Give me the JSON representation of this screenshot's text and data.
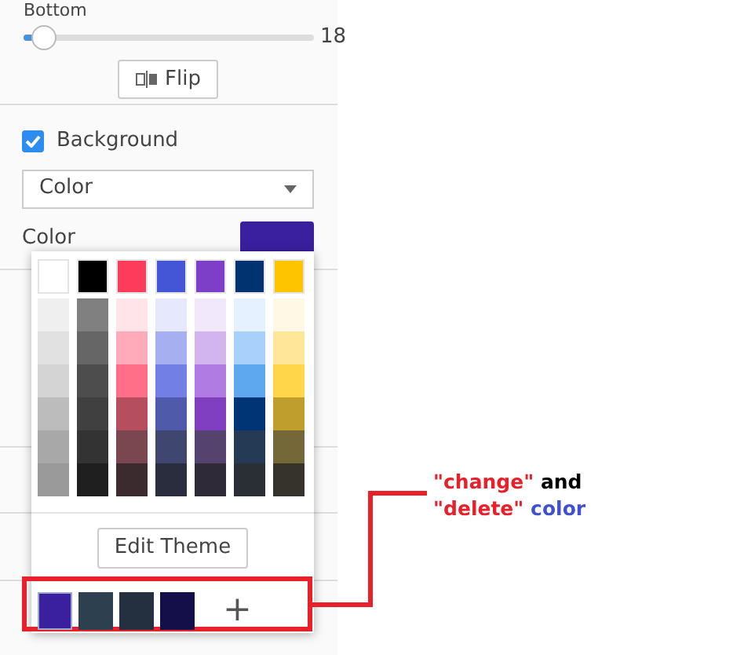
{
  "slider": {
    "label": "Bottom",
    "level": 0.07,
    "reading": "18"
  },
  "flip_button": {
    "label": "Flip"
  },
  "background": {
    "label": "Background",
    "checked": true,
    "fill_type": "Color",
    "color_label": "Color",
    "color": "#3a1f9e"
  },
  "color_picker": {
    "theme_colors": [
      {
        "color": "#ffffff"
      },
      {
        "color": "#000000"
      },
      {
        "color": "#ff3b5b"
      },
      {
        "color": "#4455d6"
      },
      {
        "color": "#7e3fc8"
      },
      {
        "color": "#003370"
      },
      {
        "color": "#ffc400"
      }
    ],
    "shades": [
      [
        {
          "color": "#efefef"
        },
        {
          "color": "#808080"
        },
        {
          "color": "#ffe5ea"
        },
        {
          "color": "#e6e9fb"
        },
        {
          "color": "#f1e8fb"
        },
        {
          "color": "#e5f1ff"
        },
        {
          "color": "#fff8e5"
        }
      ],
      [
        {
          "color": "#e1e1e1"
        },
        {
          "color": "#666666"
        },
        {
          "color": "#ffabb9"
        },
        {
          "color": "#a6afef"
        },
        {
          "color": "#d2b4ef"
        },
        {
          "color": "#a8d0fa"
        },
        {
          "color": "#ffe699"
        }
      ],
      [
        {
          "color": "#d4d4d4"
        },
        {
          "color": "#4d4d4d"
        },
        {
          "color": "#ff7088"
        },
        {
          "color": "#7280e6"
        },
        {
          "color": "#b07be3"
        },
        {
          "color": "#5ea8f0"
        },
        {
          "color": "#ffd54a"
        }
      ],
      [
        {
          "color": "#bcbcbc"
        },
        {
          "color": "#404040"
        },
        {
          "color": "#b54f60"
        },
        {
          "color": "#4f5aaa"
        },
        {
          "color": "#7f3fc0"
        },
        {
          "color": "#003575"
        },
        {
          "color": "#bf9e2e"
        }
      ],
      [
        {
          "color": "#a8a8a8"
        },
        {
          "color": "#333333"
        },
        {
          "color": "#7a4650"
        },
        {
          "color": "#3f4670"
        },
        {
          "color": "#56426f"
        },
        {
          "color": "#243a55"
        },
        {
          "color": "#756838"
        }
      ],
      [
        {
          "color": "#9a9a9a"
        },
        {
          "color": "#1f1f1f"
        },
        {
          "color": "#3b2a2e"
        },
        {
          "color": "#2a2d3e"
        },
        {
          "color": "#2f2a38"
        },
        {
          "color": "#2a2e35"
        },
        {
          "color": "#35332c"
        }
      ]
    ],
    "edit_button": "Edit Theme",
    "recent_colors": [
      {
        "color": "#3a1f9e",
        "selected": true
      },
      {
        "color": "#2d4050",
        "selected": false
      },
      {
        "color": "#243040",
        "selected": false
      },
      {
        "color": "#140f48",
        "selected": false
      }
    ],
    "add_label": "+"
  },
  "annotation": {
    "lines": [
      [
        {
          "text": "\"change\"",
          "color": "#e8202a"
        },
        {
          "text": "and",
          "color": "#000000"
        }
      ],
      [
        {
          "text": "\"delete\"",
          "color": "#e8202a"
        },
        {
          "text": "color",
          "color": "#4050d0"
        }
      ]
    ]
  }
}
